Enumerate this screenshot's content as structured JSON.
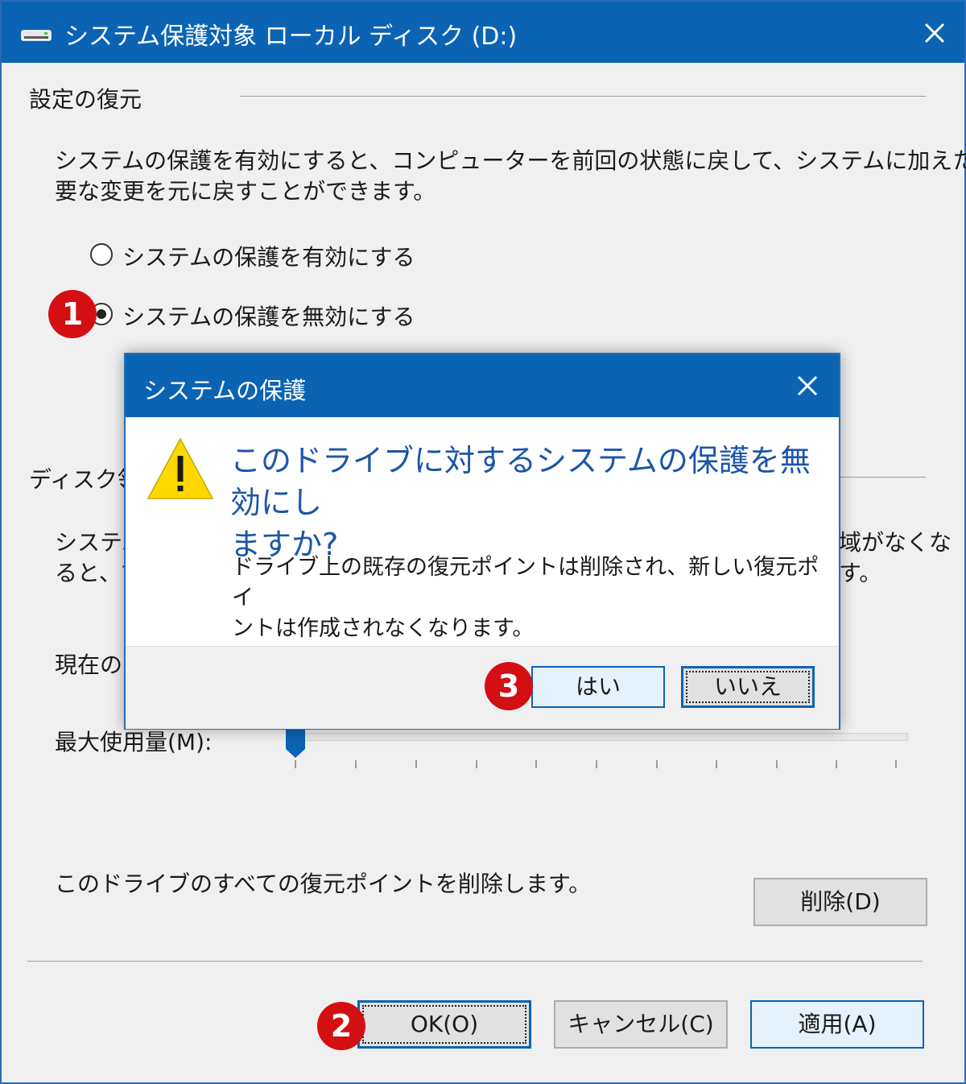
{
  "window": {
    "title": "システム保護対象 ローカル ディスク (D:)",
    "icon": "drive-icon",
    "close_icon": "close-icon"
  },
  "restore_section": {
    "heading": "設定の復元",
    "description_line1": "システムの保護を有効にすると、コンピューターを前回の状態に戻して、システムに加えた不",
    "description_line2": "要な変更を元に戻すことができます。",
    "radio_enable": "システムの保護を有効にする",
    "radio_disable": "システムの保護を無効にする",
    "selected": "disable"
  },
  "disk_section": {
    "heading_partial": "ディスク領",
    "text_left_line1": "システム",
    "text_left_line2": "ると、古",
    "text_right_line1": "域がなくな",
    "text_right_line2": "す。",
    "current_partial": "現在の",
    "max_usage_label": "最大使用量(M):",
    "slider_value": 0
  },
  "delete_section": {
    "text": "このドライブのすべての復元ポイントを削除します。",
    "delete_button": "削除(D)"
  },
  "buttons": {
    "ok": "OK(O)",
    "cancel": "キャンセル(C)",
    "apply": "適用(A)"
  },
  "badges": {
    "b1": "1",
    "b2": "2",
    "b3": "3"
  },
  "dialog": {
    "title": "システムの保護",
    "main_line1": "このドライブに対するシステムの保護を無効にし",
    "main_line2": "ますか?",
    "sub_line1": "ドライブ上の既存の復元ポイントは削除され、新しい復元ポイ",
    "sub_line2": "ントは作成されなくなります。",
    "yes": "はい",
    "no": "いいえ",
    "icon": "warning-icon"
  },
  "colors": {
    "titlebar": "#0b63b4",
    "badge": "#d40f14",
    "dialog_heading": "#1c55a8"
  }
}
